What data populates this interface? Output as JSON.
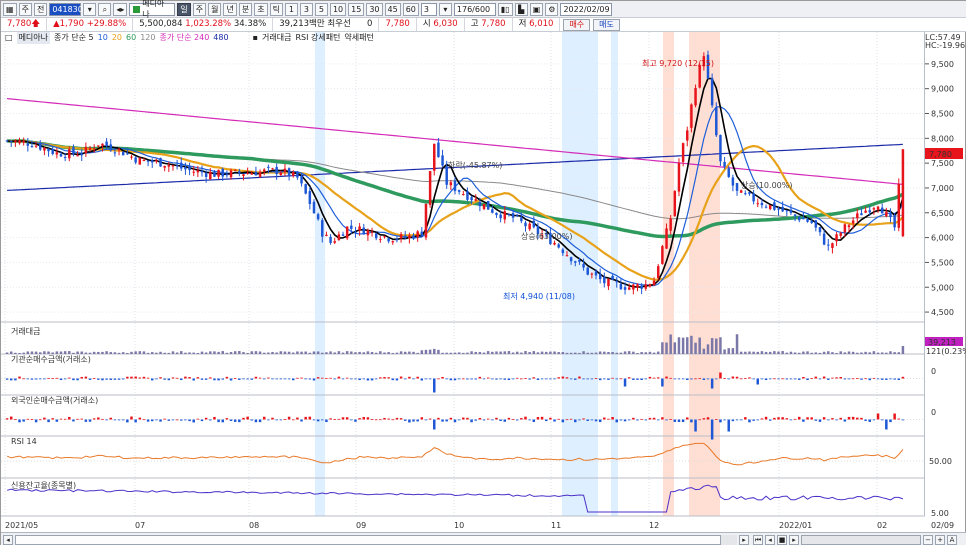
{
  "toolbar": {
    "mode_buttons": [
      "주",
      "전"
    ],
    "stock_code": "041830",
    "stock_name": "메디아나",
    "period_buttons": [
      "일",
      "주",
      "월",
      "년",
      "분",
      "초",
      "틱"
    ],
    "interval_buttons": [
      "1",
      "3",
      "5",
      "10",
      "15",
      "30",
      "45",
      "60"
    ],
    "count_select": "3",
    "range": "176/600",
    "date": "2022/02/09"
  },
  "quote": {
    "price": "7,780",
    "change": "1,790",
    "change_pct": "+29.88%",
    "volume": "5,500,084",
    "volume_ratio": "1,023.28%",
    "turnover": "34.38%",
    "amount": "39,213백만",
    "priority_label": "최우선",
    "priority_value": "0",
    "ask": "7,780",
    "open_label": "시",
    "open": "6,030",
    "high_label": "고",
    "high": "7,780",
    "low_label": "저",
    "low": "6,010",
    "buy_label": "매수",
    "sell_label": "매도"
  },
  "legend": {
    "name": "메디아나",
    "ma_short_label": "종가 단순 5",
    "ma_short": [
      "10",
      "20",
      "60",
      "120"
    ],
    "ma_long_label": "종가 단순 240",
    "ma_long_extra": "480",
    "volume_label": "거래대금",
    "rsi_pattern": "RSI 강세패턴",
    "weak_pattern": "약세패턴"
  },
  "lc_hc": {
    "lc": "LC:57.49",
    "hc": "HC:-19.96"
  },
  "price_axis": [
    "9,500",
    "9,000",
    "8,500",
    "8,000",
    "7,500",
    "7,000",
    "6,500",
    "6,000",
    "5,500",
    "5,000",
    "4,500"
  ],
  "price_tag": "7,780",
  "annotations": {
    "high": "최고 9,720 (12/15)",
    "low": "최저 4,940 (11/08)",
    "drop": "하락(-45.87%)",
    "rise": "상승(63.00%)",
    "rise2": "상승(10.00%)"
  },
  "panes": {
    "volume": {
      "title": "거래대금",
      "tag1": "39,213",
      "tag2": "121(0.23%)"
    },
    "inst": {
      "title": "기관순매수금액(거래소)",
      "zero": "0"
    },
    "foreign": {
      "title": "외국인순매수금액(거래소)",
      "zero": "0"
    },
    "rsi": {
      "title": "RSI 14",
      "level": "50.00"
    },
    "credit": {
      "title": "신용잔고율(종목별)",
      "level": "5.00"
    }
  },
  "x_axis": [
    "2021/05",
    "07",
    "08",
    "09",
    "10",
    "11",
    "12",
    "2022/01",
    "02",
    "02/09"
  ],
  "colors": {
    "up": "#e8141c",
    "down": "#1d57d6",
    "ma5": "#000000",
    "ma10": "#1e5fd8",
    "ma20": "#e8a21a",
    "ma60": "#2e9a5e",
    "ma120": "#8a8a8a",
    "ma240": "#d42bb8",
    "ma480": "#1a2aa8"
  }
}
